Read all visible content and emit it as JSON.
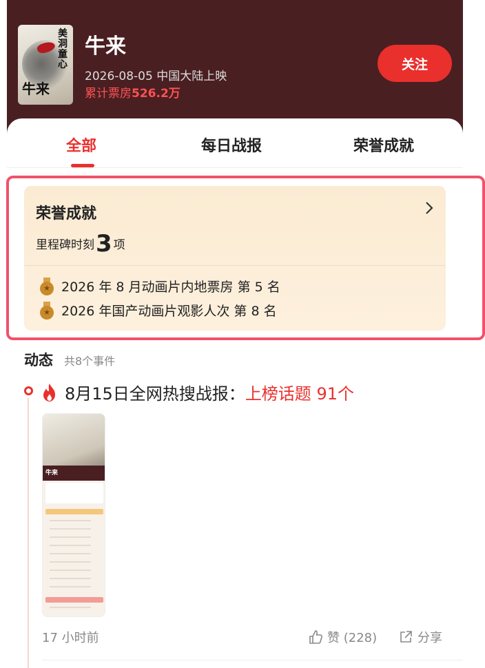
{
  "header": {
    "poster_title": "牛来",
    "poster_vertical_text": "美洞童心",
    "movie_title": "牛来",
    "release_info": "2026-08-05 中国大陆上映",
    "box_office_label": "累计票房",
    "box_office_value": "526.2万",
    "follow_label": "关注"
  },
  "tabs": [
    "全部",
    "每日战报",
    "荣誉成就"
  ],
  "honor": {
    "title": "荣誉成就",
    "milestone_prefix": "里程碑时刻",
    "milestone_count": "3",
    "milestone_suffix": "项",
    "items": [
      "2026 年 8 月动画片内地票房 第 5 名",
      "2026 年国产动画片观影人次 第 8 名"
    ]
  },
  "dynamics": {
    "title": "动态",
    "count": "共8个事件",
    "event": {
      "text": "8月15日全网热搜战报：",
      "highlight": "上榜话题 91个",
      "thumb_label": "牛来",
      "time": "17 小时前",
      "like_label": "赞 (228)",
      "share_label": "分享"
    }
  },
  "colors": {
    "header_bg": "#4a1f22",
    "accent": "#e9302d",
    "honor_bg": "#fbebd3",
    "highlight_border": "#f0526a"
  }
}
